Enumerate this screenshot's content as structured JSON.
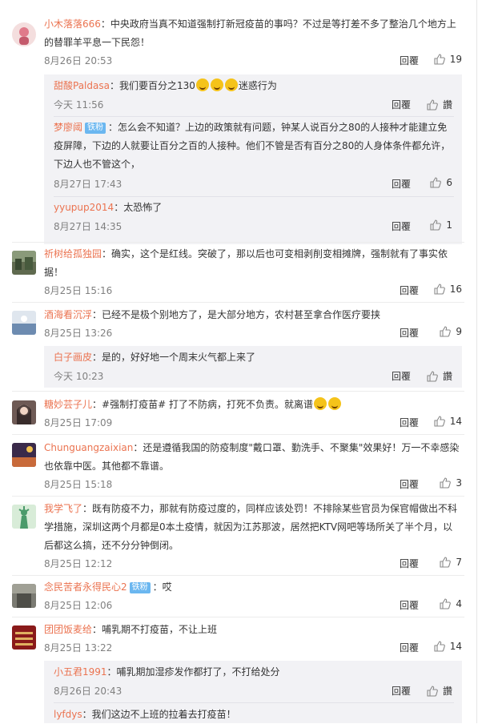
{
  "ui": {
    "reply_label": "回覆",
    "like_word": "讚",
    "fan_badge": "铁粉"
  },
  "comments": [
    {
      "user": "小木落落666",
      "text": "：中央政府当真不知道强制打新冠疫苗的事吗？不过是等打差不多了整治几个地方上的替罪羊平息一下民怨！",
      "time": "8月26日 20:53",
      "likes": "19",
      "replies": [
        {
          "user": "甜酸Paldasa",
          "text": "：我们要百分之130",
          "text2": "迷惑行为",
          "time": "今天 11:56",
          "likes": "讚"
        },
        {
          "user": "梦廖阈",
          "badge": "铁粉",
          "text": "：怎么会不知道？上边的政策就有问题，钟某人说百分之80的人接种才能建立免疫屏障，下边的人就要让百分之百的人接种。他们不管是否有百分之80的人身体条件都允许，下边人也不管这个，",
          "time": "8月27日 17:43",
          "likes": "6"
        },
        {
          "user": "yyupup2014",
          "text": "：太恐怖了",
          "time": "8月27日 14:35",
          "likes": "1"
        }
      ]
    },
    {
      "user": "祈树给孤独园",
      "text": "：确实，这个是红线。突破了，那以后也可变相剥削变相摊牌，强制就有了事实依据！",
      "time": "8月25日 15:16",
      "likes": "16"
    },
    {
      "user": "酒海看沉浮",
      "text": "：已经不是极个别地方了，是大部分地方，农村甚至拿合作医疗要挟",
      "time": "8月25日 13:26",
      "likes": "9",
      "replies": [
        {
          "user": "白子画皮",
          "text": "：是的，好好地一个周末火气都上来了",
          "time": "今天 10:23",
          "likes": "讚"
        }
      ]
    },
    {
      "user": "糖妙芸子儿",
      "text": "：#强制打疫苗# 打了不防病，打死不负责。就离谱",
      "time": "8月25日 17:09",
      "likes": "14"
    },
    {
      "user": "Chunguangzaixian",
      "text": "：还是遵循我国的防疫制度\"戴口罩、勤洗手、不聚集\"效果好！万一不幸感染也依靠中医。其他都不靠谱。",
      "time": "8月25日 15:18",
      "likes": "3"
    },
    {
      "user": "我学飞了",
      "text": "：既有防疫不力，那就有防疫过度的，同样应该处罚！不排除某些官员为保官帽做出不科学措施，深圳这两个月都是0本土疫情，就因为江苏那波，居然把KTV网吧等场所关了半个月，以后都这么搞，还不分分钟倒闭。",
      "time": "8月25日 12:12",
      "likes": "7"
    },
    {
      "user": "念民苦者永得民心2",
      "badge": "铁粉",
      "text": "：哎",
      "time": "8月25日 12:06",
      "likes": "4"
    },
    {
      "user": "团团饭麦给",
      "text": "：哺乳期不打疫苗，不让上班",
      "time": "8月25日 13:22",
      "likes": "14",
      "replies": [
        {
          "user": "小五君1991",
          "text": "：哺乳期加湿疹发作都打了，不打给处分",
          "time": "8月26日 20:43",
          "likes": "讚"
        },
        {
          "user": "lyfdys",
          "text": "：我们这边不上班的拉着去打疫苗！",
          "time": "",
          "likes": ""
        }
      ]
    }
  ],
  "colors": {
    "username": "#eb7350",
    "sub_bg": "#f2f2f5",
    "badge": "#6bb7f0"
  },
  "icons": {
    "like": "thumbs-up-icon",
    "emoji": "smile-emoji-icon"
  }
}
